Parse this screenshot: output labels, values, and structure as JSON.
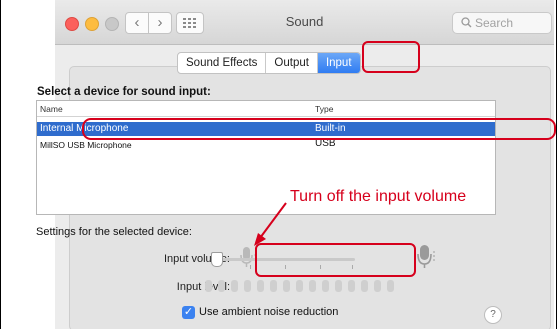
{
  "window": {
    "title": "Sound"
  },
  "search": {
    "placeholder": "Search"
  },
  "tabs": [
    {
      "label": "Sound Effects",
      "active": false
    },
    {
      "label": "Output",
      "active": false
    },
    {
      "label": "Input",
      "active": true
    }
  ],
  "devices": {
    "heading": "Select a device for sound input:",
    "columns": {
      "name": "Name",
      "type": "Type"
    },
    "rows": [
      {
        "name": "Internal Microphone",
        "type": "Built-in",
        "selected": true
      },
      {
        "name": "MillSO USB Microphone",
        "type": "USB",
        "selected": false
      }
    ]
  },
  "settings": {
    "heading": "Settings for the selected device:",
    "input_volume_label": "Input volume:",
    "input_volume_value": 0.0,
    "input_level_label": "Input level:",
    "ambient_label": "Use ambient noise reduction",
    "ambient_checked": true
  },
  "annotation": {
    "text": "Turn off the input volume",
    "color": "#d6001c"
  },
  "icons": [
    "search-icon",
    "grid-icon",
    "microphone-low-icon",
    "microphone-high-icon",
    "help-icon"
  ],
  "colors": {
    "selection": "#2f6ccd",
    "accent": "#2f7cf2",
    "close": "#fc605c",
    "minimize": "#fdbc40"
  }
}
